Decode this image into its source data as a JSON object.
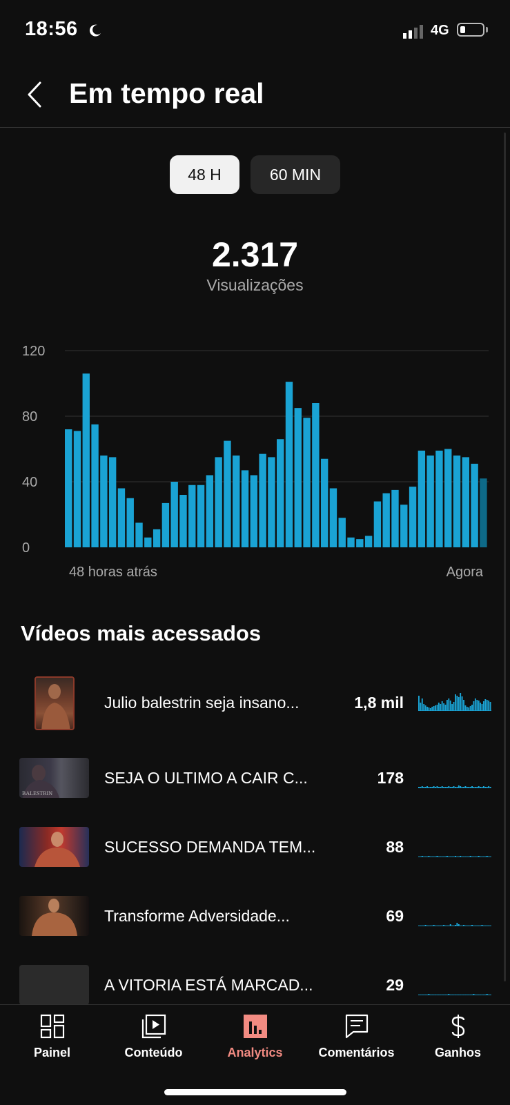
{
  "status_bar": {
    "time": "18:56",
    "network": "4G"
  },
  "header": {
    "title": "Em tempo real"
  },
  "toggle": {
    "options": [
      "48 H",
      "60 MIN"
    ],
    "selected": "48 H"
  },
  "summary": {
    "total": "2.317",
    "label": "Visualizações"
  },
  "chart_data": {
    "type": "bar",
    "title": "",
    "xlabel": "",
    "ylabel": "",
    "ylim": [
      0,
      120
    ],
    "yticks": [
      0,
      40,
      80,
      120
    ],
    "x_start_label": "48 horas atrás",
    "x_end_label": "Agora",
    "grid": true,
    "values": [
      72,
      71,
      106,
      75,
      56,
      55,
      36,
      30,
      15,
      6,
      11,
      27,
      40,
      32,
      38,
      38,
      44,
      55,
      65,
      56,
      47,
      44,
      57,
      55,
      66,
      101,
      85,
      79,
      88,
      54,
      36,
      18,
      6,
      5,
      7,
      28,
      33,
      35,
      26,
      37,
      59,
      56,
      59,
      60,
      56,
      55,
      51,
      42
    ],
    "partial_last_bar": true
  },
  "top_videos": {
    "title": "Vídeos mais acessados",
    "items": [
      {
        "title": "Julio balestrin seja insano...",
        "count": "1,8 mil",
        "thumb_text": ""
      },
      {
        "title": "SEJA O ULTIMO A CAIR C...",
        "count": "178",
        "thumb_text": "BALESTRIN"
      },
      {
        "title": "SUCESSO DEMANDA TEM...",
        "count": "88",
        "thumb_text": ""
      },
      {
        "title": "Transforme Adversidade...",
        "count": "69",
        "thumb_text": ""
      },
      {
        "title": "A VITORIA ESTÁ MARCAD...",
        "count": "29",
        "thumb_text": ""
      }
    ]
  },
  "bottom_nav": {
    "items": [
      {
        "label": "Painel",
        "icon": "dashboard-icon"
      },
      {
        "label": "Conteúdo",
        "icon": "content-icon"
      },
      {
        "label": "Analytics",
        "icon": "analytics-icon"
      },
      {
        "label": "Comentários",
        "icon": "comments-icon"
      },
      {
        "label": "Ganhos",
        "icon": "earnings-icon"
      }
    ],
    "active": "Analytics"
  },
  "colors": {
    "accent": "#f28b82",
    "bar": "#1aa3d4",
    "bar_partial": "#0e6a88",
    "background": "#0f0f0f"
  }
}
